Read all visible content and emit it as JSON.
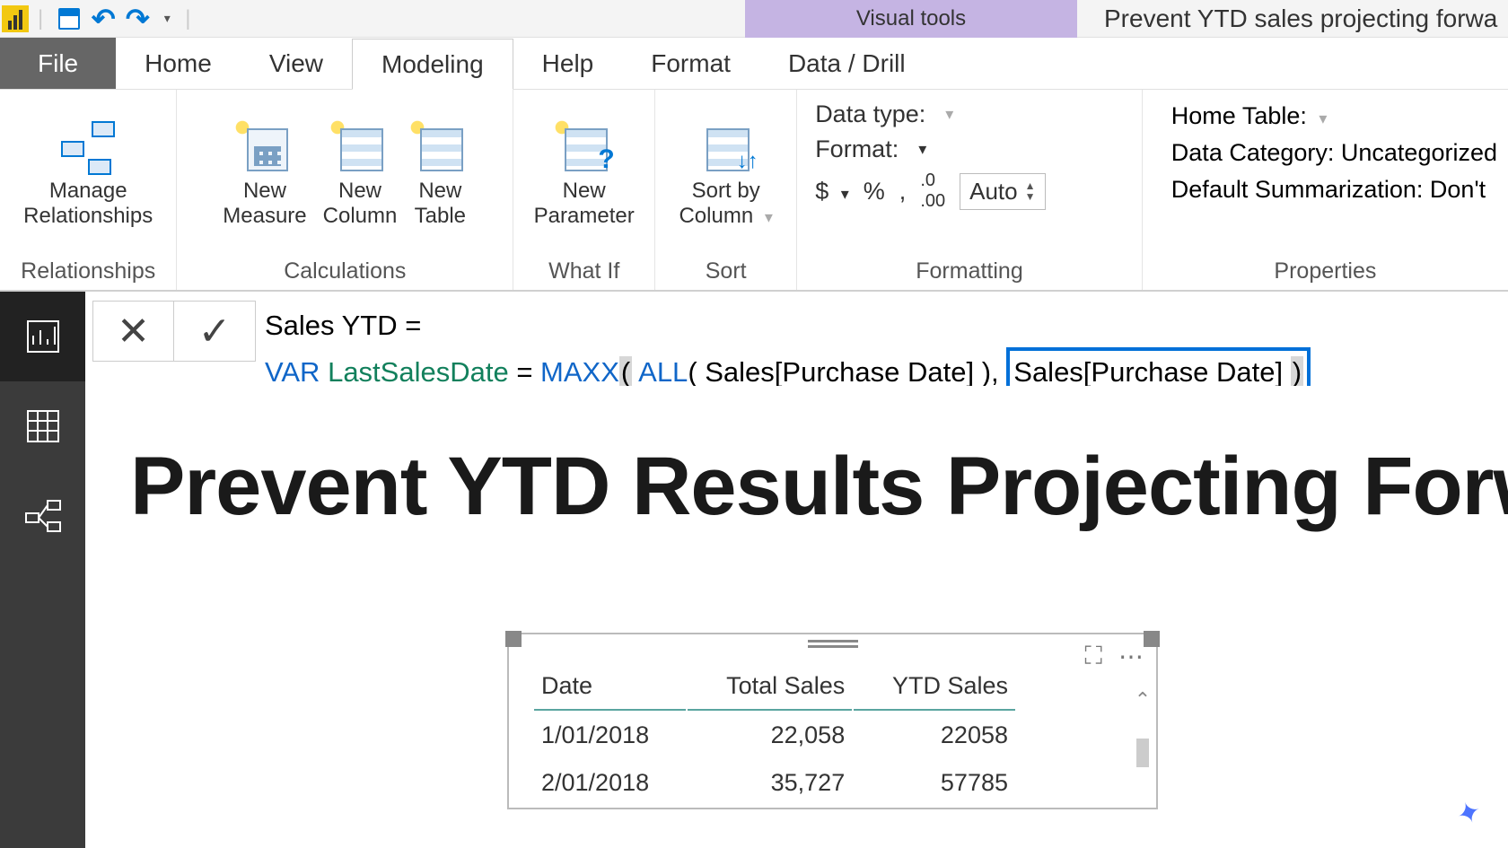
{
  "titlebar": {
    "context_tab": "Visual tools",
    "doc_title": "Prevent YTD sales projecting forwa"
  },
  "tabs": {
    "file": "File",
    "home": "Home",
    "view": "View",
    "modeling": "Modeling",
    "help": "Help",
    "format": "Format",
    "datadrill": "Data / Drill"
  },
  "ribbon": {
    "relationships": {
      "manage": "Manage\nRelationships",
      "group": "Relationships"
    },
    "calculations": {
      "measure": "New\nMeasure",
      "column": "New\nColumn",
      "table": "New\nTable",
      "group": "Calculations"
    },
    "whatif": {
      "param": "New\nParameter",
      "group": "What If"
    },
    "sort": {
      "sortby": "Sort by\nColumn",
      "group": "Sort"
    },
    "formatting": {
      "datatype": "Data type:",
      "format": "Format:",
      "dollar": "$",
      "percent": "%",
      "comma": ",",
      "decimals": ".00",
      "auto": "Auto",
      "group": "Formatting"
    },
    "properties": {
      "hometable": "Home Table:",
      "datacat": "Data Category: Uncategorized",
      "summ": "Default Summarization: Don't",
      "group": "Properties"
    }
  },
  "formula": {
    "line1": "Sales YTD =",
    "var_kw": "VAR",
    "var_name": "LastSalesDate",
    "eq": " = ",
    "maxx": "MAXX",
    "open1": "(",
    "all": "ALL",
    "arg1": "( Sales[Purchase Date] ),",
    "arg2": "Sales[Purchase Date] ",
    "close": ")"
  },
  "canvas": {
    "title": "Prevent YTD Results Projecting Forw"
  },
  "table": {
    "headers": {
      "date": "Date",
      "total": "Total Sales",
      "ytd": "YTD Sales"
    },
    "rows": [
      {
        "date": "1/01/2018",
        "total": "22,058",
        "ytd": "22058"
      },
      {
        "date": "2/01/2018",
        "total": "35,727",
        "ytd": "57785"
      }
    ]
  }
}
